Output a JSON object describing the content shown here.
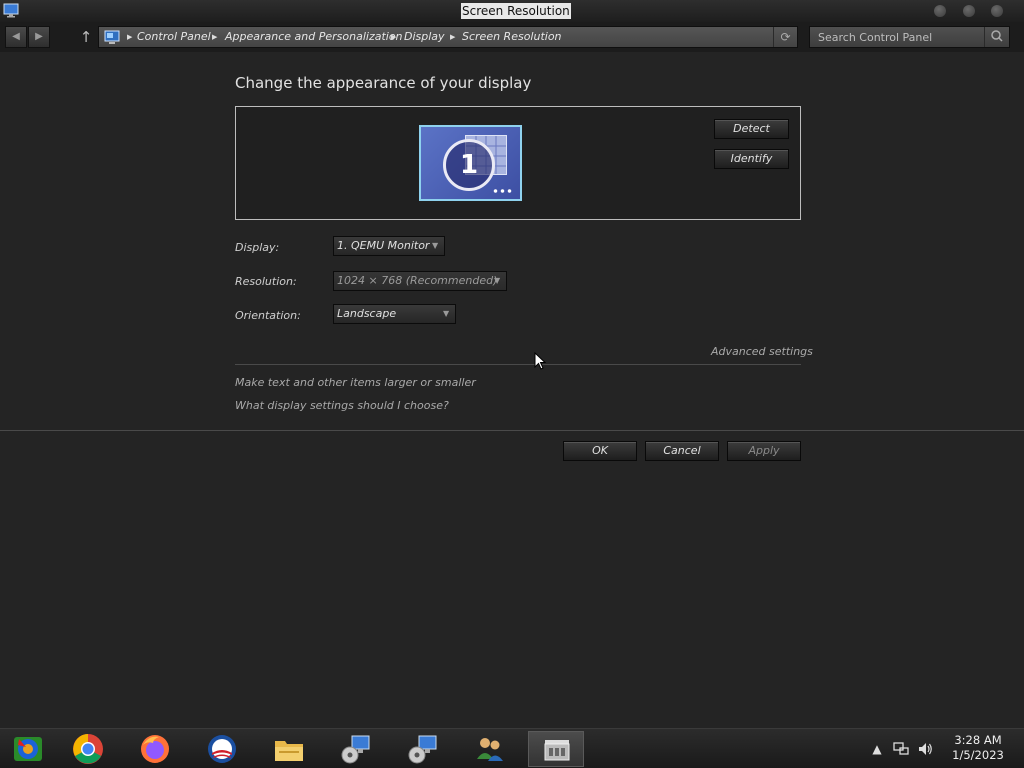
{
  "window": {
    "title": "Screen Resolution"
  },
  "nav": {
    "breadcrumbs": [
      "Control Panel",
      "Appearance and Personalization",
      "Display",
      "Screen Resolution"
    ],
    "search_placeholder": "Search Control Panel"
  },
  "main": {
    "heading": "Change the appearance of your display",
    "monitor_number": "1",
    "detect_label": "Detect",
    "identify_label": "Identify",
    "display_label": "Display:",
    "display_value": "1. QEMU Monitor",
    "resolution_label": "Resolution:",
    "resolution_value": "1024 × 768 (Recommended)",
    "orientation_label": "Orientation:",
    "orientation_value": "Landscape",
    "advanced_link": "Advanced settings",
    "text_size_link": "Make text and other items larger or smaller",
    "help_link": "What display settings should I choose?",
    "ok_label": "OK",
    "cancel_label": "Cancel",
    "apply_label": "Apply"
  },
  "taskbar": {
    "items": [
      "media-center-icon",
      "chrome-icon",
      "firefox-icon",
      "obama-logo-icon",
      "file-explorer-icon",
      "network-setup-icon",
      "network-setup-icon",
      "users-icon",
      "control-panel-icon"
    ],
    "time": "3:28 AM",
    "date": "1/5/2023"
  },
  "colors": {
    "background": "#242424",
    "taskbar": "#1e1e1e",
    "monitor_border": "#8fd2ee",
    "monitor_fill": "#4b60b4"
  }
}
